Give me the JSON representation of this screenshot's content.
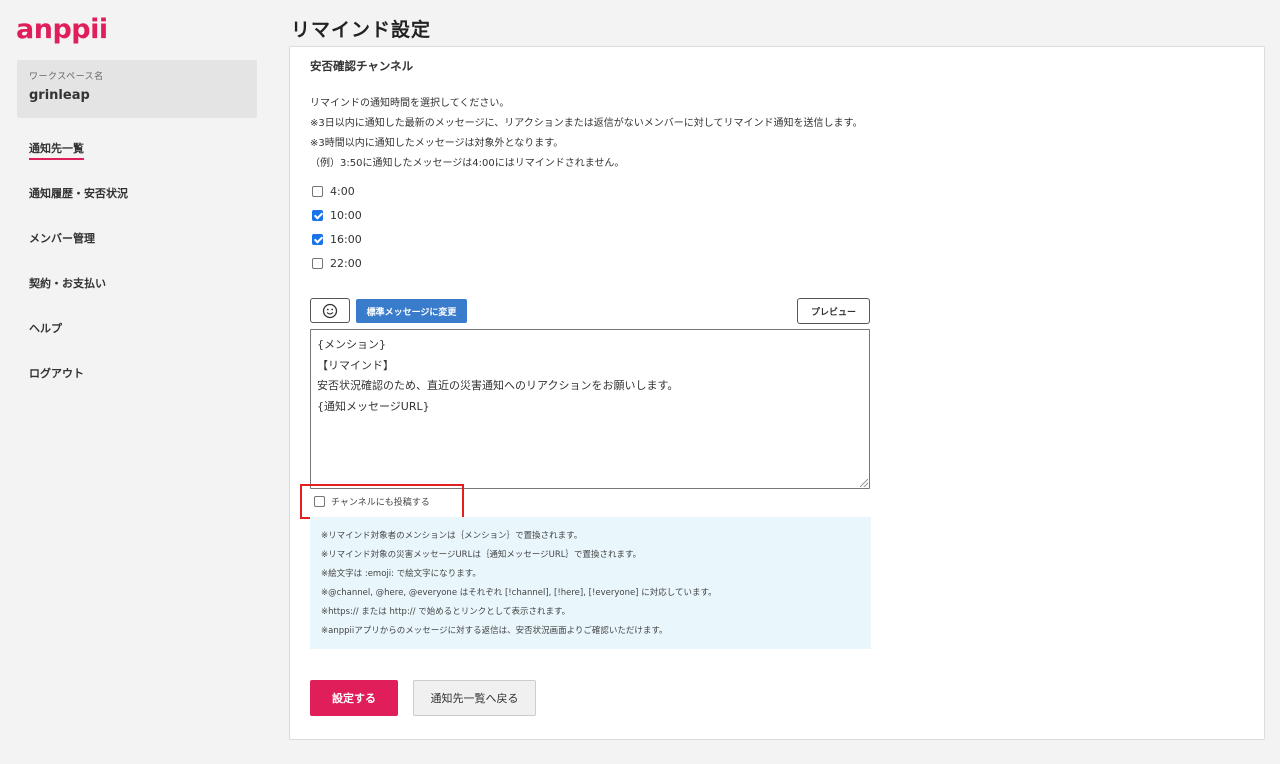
{
  "app": {
    "logo": "anppii"
  },
  "workspace": {
    "label": "ワークスペース名",
    "name": "grinleap"
  },
  "sidebar": {
    "items": [
      {
        "label": "通知先一覧",
        "active": true
      },
      {
        "label": "通知履歴・安否状況"
      },
      {
        "label": "メンバー管理"
      },
      {
        "label": "契約・お支払い"
      },
      {
        "label": "ヘルプ"
      },
      {
        "label": "ログアウト"
      }
    ]
  },
  "page": {
    "title": "リマインド設定"
  },
  "section": {
    "title": "安否確認チャンネル",
    "description": [
      "リマインドの通知時間を選択してください。",
      "※3日以内に通知した最新のメッセージに、リアクションまたは返信がないメンバーに対してリマインド通知を送信します。",
      "※3時間以内に通知したメッセージは対象外となります。",
      "（例）3:50に通知したメッセージは4:00にはリマインドされません。"
    ]
  },
  "times": [
    {
      "label": "4:00",
      "checked": false
    },
    {
      "label": "10:00",
      "checked": true
    },
    {
      "label": "16:00",
      "checked": true
    },
    {
      "label": "22:00",
      "checked": false
    }
  ],
  "toolbar": {
    "emoji_icon": "smiley-icon",
    "standard_label": "標準メッセージに変更",
    "preview_label": "プレビュー"
  },
  "message": {
    "lines": [
      "{メンション}",
      "【リマインド】",
      "安否状況確認のため、直近の災害通知へのリアクションをお願いします。",
      "{通知メッセージURL}"
    ]
  },
  "post_channel": {
    "label": "チャンネルにも投稿する",
    "checked": false
  },
  "notes": [
    "※リマインド対象者のメンションは｛メンション｝で置換されます。",
    "※リマインド対象の災害メッセージURLは｛通知メッセージURL｝で置換されます。",
    "※絵文字は :emoji: で絵文字になります。",
    "※@channel, @here, @everyone はそれぞれ [!channel], [!here], [!everyone] に対応しています。",
    "※https:// または http:// で始めるとリンクとして表示されます。",
    "※anppiiアプリからのメッセージに対する返信は、安否状況画面よりご確認いただけます。"
  ],
  "actions": {
    "submit_label": "設定する",
    "back_label": "通知先一覧へ戻る"
  },
  "colors": {
    "brand": "#e01e5a",
    "button_blue": "#3a7ccc",
    "highlight_red": "#e32020",
    "notes_bg": "#e9f6fb"
  }
}
